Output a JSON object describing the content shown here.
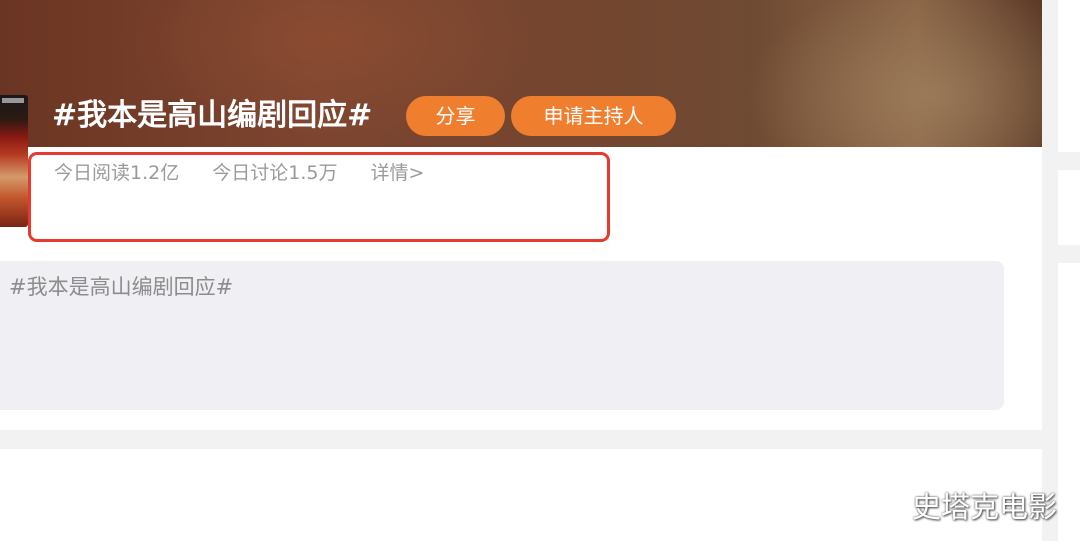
{
  "topic": {
    "title": "#我本是高山编剧回应#",
    "share_label": "分享",
    "host_label": "申请主持人"
  },
  "stats": {
    "reads": "今日阅读1.2亿",
    "discussions": "今日讨论1.5万",
    "details_link": "详情>"
  },
  "composer": {
    "text": "#我本是高山编剧回应#"
  },
  "watermark": "史塔克电影",
  "colors": {
    "accent_orange": "#f07e2f",
    "highlight_red": "#e8392d",
    "stats_gray": "#9a9a9a",
    "composer_bg": "#f0f0f4"
  }
}
